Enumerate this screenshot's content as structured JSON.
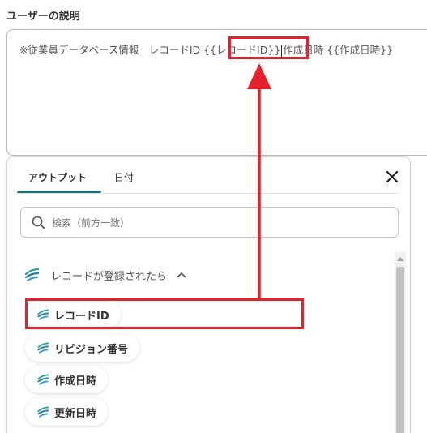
{
  "field": {
    "label": "ユーザーの説明",
    "text_prefix": "※従業員データベース情報　レコードID",
    "token_record_id": "{{レコードID}}",
    "text_middle": "作成日時",
    "token_created_at": "{{作成日時}}"
  },
  "panel": {
    "tabs": [
      {
        "label": "アウトプット",
        "active": true
      },
      {
        "label": "日付",
        "active": false
      }
    ],
    "search": {
      "placeholder": "検索（前方一致）",
      "value": ""
    },
    "group": {
      "label": "レコードが登録されたら"
    },
    "items": [
      {
        "label": "レコードID"
      },
      {
        "label": "リビジョン番号"
      },
      {
        "label": "作成日時"
      },
      {
        "label": "更新日時"
      }
    ]
  },
  "colors": {
    "accent": "#1e6b7a",
    "highlight": "#e5212e",
    "brand_icon": "#27a59b"
  },
  "icons": {
    "close": "close-icon",
    "search": "search-icon",
    "brand": "kintone-logo-icon",
    "chevron": "chevron-up-icon"
  }
}
